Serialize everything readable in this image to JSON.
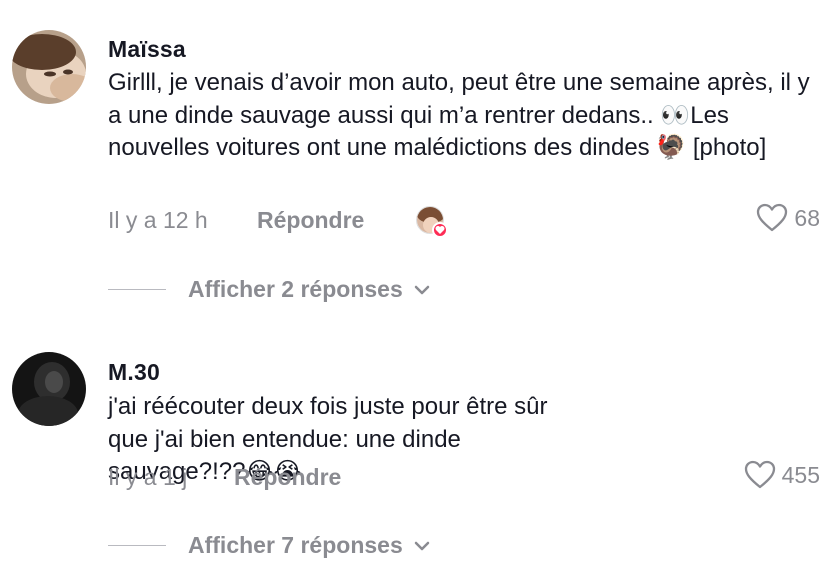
{
  "comments": [
    {
      "username": "Maïssa",
      "text": "Girlll, je venais d’avoir mon auto, peut être une semaine après, il y a une dinde sauvage aussi qui m’a rentrer dedans.. 👀Les nouvelles voitures ont une malédictions des dindes 🦃 [photo]",
      "time": "Il y a 12 h",
      "reply_label": "Répondre",
      "likes": "68",
      "view_replies": "Afficher 2 réponses"
    },
    {
      "username": "M.30",
      "text": "j'ai réécouter deux fois juste pour être sûr que j'ai bien entendue: une dinde sauvage?!??😂😭",
      "time": "Il y a 1 j",
      "reply_label": "Répondre",
      "likes": "455",
      "view_replies": "Afficher 7 réponses"
    }
  ],
  "icons": {
    "like": "heart-outline-icon",
    "expand": "chevron-down-icon",
    "creator_liked": "heart-badge-icon"
  },
  "colors": {
    "text": "#161823",
    "muted": "#8a8b91",
    "like_badge": "#fe2c55"
  }
}
